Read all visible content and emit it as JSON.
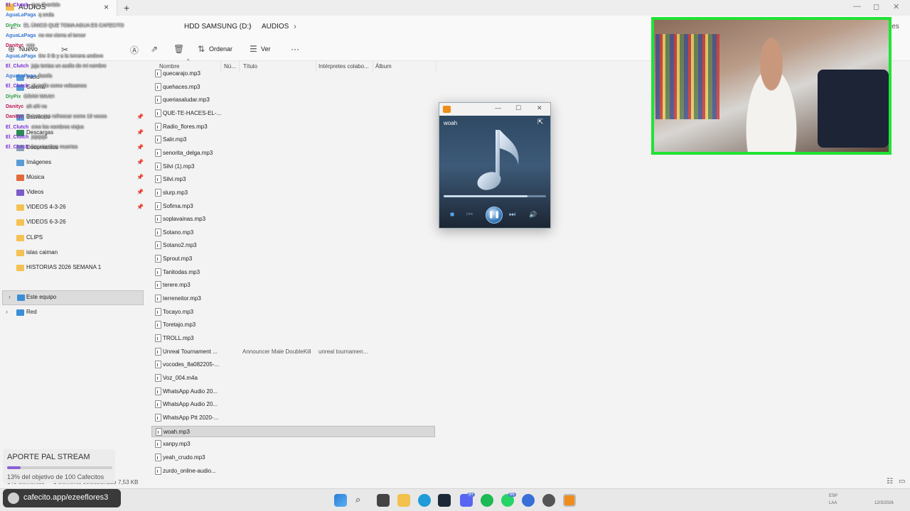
{
  "tab": {
    "label": "AUDIOS",
    "close": "×",
    "add": "+"
  },
  "window_controls": {
    "minimize": "—",
    "maximize": "◻",
    "close": "✕"
  },
  "address": {
    "back": "←",
    "crumbs": [
      "HDD SAMSUNG (D:)",
      "AUDIOS"
    ],
    "separator": "›",
    "search_fragment": "les"
  },
  "toolbar": {
    "new_label": "Nuevo",
    "sort_label": "Ordenar",
    "view_label": "Ver",
    "more_label": "···"
  },
  "sidebar": {
    "items": [
      {
        "label": "Inicio",
        "icon": "home-icon"
      },
      {
        "label": "Galería",
        "icon": "gallery-icon"
      },
      {
        "label": "Escritorio",
        "icon": "desktop-icon",
        "pinned": true
      },
      {
        "label": "Descargas",
        "icon": "download-icon",
        "pinned": true
      },
      {
        "label": "Documentos",
        "icon": "documents-icon",
        "pinned": true
      },
      {
        "label": "Imágenes",
        "icon": "pictures-icon",
        "pinned": true
      },
      {
        "label": "Música",
        "icon": "music-icon",
        "pinned": true
      },
      {
        "label": "Videos",
        "icon": "videos-icon",
        "pinned": true
      },
      {
        "label": "VIDEOS 4-3-26",
        "icon": "folder-icon",
        "pinned": true
      },
      {
        "label": "VIDEOS 6-3-26",
        "icon": "folder-icon"
      },
      {
        "label": "CLIPS",
        "icon": "folder-icon"
      },
      {
        "label": "islas caiman",
        "icon": "folder-icon"
      },
      {
        "label": "HISTORIAS 2026 SEMANA 1",
        "icon": "folder-icon"
      }
    ],
    "this_pc": "Este equipo",
    "network": "Red"
  },
  "columns": {
    "name": "Nombre",
    "number": "Nú...",
    "title": "Título",
    "artists": "Intérpretes colabo...",
    "album": "Álbum"
  },
  "files": [
    {
      "name": "quecarajo.mp3"
    },
    {
      "name": "quehaces.mp3"
    },
    {
      "name": "queriasaludar.mp3"
    },
    {
      "name": "QUE-TE-HACES-EL-..."
    },
    {
      "name": "Radio_flores.mp3"
    },
    {
      "name": "Salir.mp3"
    },
    {
      "name": "senorita_delga.mp3"
    },
    {
      "name": "Silvi (1).mp3"
    },
    {
      "name": "Silvi.mp3"
    },
    {
      "name": "slurp.mp3"
    },
    {
      "name": "Sofima.mp3"
    },
    {
      "name": "soplavainas.mp3"
    },
    {
      "name": "Sotano.mp3"
    },
    {
      "name": "Sotano2.mp3"
    },
    {
      "name": "Sprout.mp3"
    },
    {
      "name": "Tanitodas.mp3"
    },
    {
      "name": "terere.mp3"
    },
    {
      "name": "terreneitor.mp3"
    },
    {
      "name": "Tocayo.mp3"
    },
    {
      "name": "Toretajo.mp3"
    },
    {
      "name": "TROLL.mp3"
    },
    {
      "name": "Unreal Tournament ...",
      "title": "Announcer Male DoubleKill",
      "artist": "unreal tournamen..."
    },
    {
      "name": "vocodes_8a082205-..."
    },
    {
      "name": "Voz_004.m4a"
    },
    {
      "name": "WhatsApp Audio 20..."
    },
    {
      "name": "WhatsApp Audio 20..."
    },
    {
      "name": "WhatsApp Ptt 2020-..."
    },
    {
      "name": "woah.mp3",
      "selected": true
    },
    {
      "name": "xanpy.mp3"
    },
    {
      "name": "yeah_crudo.mp3"
    },
    {
      "name": "zurdo_online-audio..."
    }
  ],
  "status": {
    "count": "146 elementos",
    "selected": "1 elemento seleccionado",
    "size": "7,53 KB"
  },
  "player": {
    "track": "woah",
    "progress": 0.82,
    "stop": "■",
    "prev": "⏮",
    "play": "❚❚",
    "next": "⏭",
    "volume": "🔊",
    "switch": "⇱",
    "minimize": "—",
    "maximize": "☐",
    "close": "✕"
  },
  "chat": [
    {
      "user": "El_Clutch",
      "color": "#7a2fd6",
      "msg": "que divertido"
    },
    {
      "user": "AguaLaPaga",
      "color": "#3a7bd5",
      "msg": "q onda"
    },
    {
      "user": "DiyPix",
      "color": "#2f9e44",
      "msg": "EL ÚNICO QUE TOMA AGUA ES CAFECITO"
    },
    {
      "user": "AguaLaPaga",
      "color": "#3a7bd5",
      "msg": "no me cierra el tercer"
    },
    {
      "user": "Danityc",
      "color": "#c2185b",
      "msg": "vop"
    },
    {
      "user": "AguaLaPaga",
      "color": "#3a7bd5",
      "msg": "tire 3 tb y a la tercera andovo"
    },
    {
      "user": "El_Clutch",
      "color": "#7a2fd6",
      "msg": "jaja tenias un audio de mi nombre"
    },
    {
      "user": "AguaLaPaga",
      "color": "#3a7bd5",
      "msg": "fasola"
    },
    {
      "user": "El_Clutch",
      "color": "#7a2fd6",
      "msg": "el audio como volteamos"
    },
    {
      "user": "DiyPix",
      "color": "#2f9e44",
      "msg": "GRAN WAAH"
    },
    {
      "user": "Danityc",
      "color": "#c2185b",
      "msg": "ah ahi va"
    },
    {
      "user": "Danityc",
      "color": "#c2185b",
      "msg": "lo tuve que refrescar como 10 veces"
    },
    {
      "user": "El_Clutch",
      "color": "#7a2fd6",
      "msg": "creo los nombres viejos"
    },
    {
      "user": "El_Clutch",
      "color": "#7a2fd6",
      "msg": "jajajaja"
    },
    {
      "user": "El_Clutch",
      "color": "#7a2fd6",
      "msg": "hay muchos muertos"
    }
  ],
  "donation": {
    "title": "APORTE PAL STREAM",
    "progress": 0.13,
    "subtitle": "13% del objetivo de 100 Cafecitos"
  },
  "cafecito": {
    "url": "cafecito.app/ezeeflores3"
  },
  "taskbar": {
    "badges": {
      "discord": "9+",
      "whatsapp": "66"
    },
    "lang_top": "ESP",
    "lang_bottom": "LAA",
    "date": "12/3/2026"
  },
  "colors": {
    "webcam_border": "#20e335",
    "selected_row": "#d8d8d8",
    "donation_fill": "#8c5fd6"
  }
}
